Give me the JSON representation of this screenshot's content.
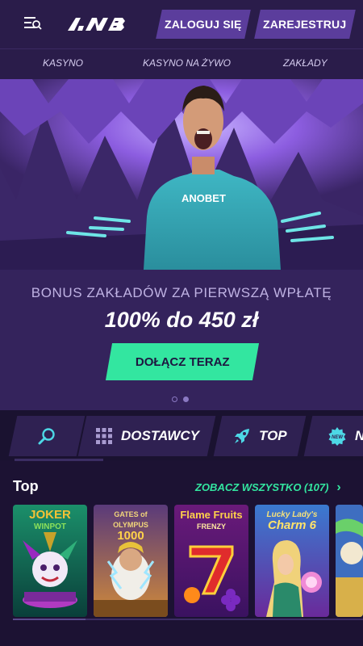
{
  "header": {
    "logo_text": "ANB",
    "login_label": "ZALOGUJ SIĘ",
    "register_label": "ZAREJESTRUJ",
    "menu_icon": "menu-search-icon"
  },
  "nav": {
    "items": [
      {
        "label": "KASYNO"
      },
      {
        "label": "KASYNO NA ŻYWO"
      },
      {
        "label": "ZAKŁADY"
      }
    ]
  },
  "hero": {
    "jersey_text": "ANOBET",
    "subtitle": "BONUS ZAKŁADÓW ZA PIERWSZĄ WPŁATĘ",
    "title": "100% do 450 zł",
    "cta_label": "DOŁĄCZ TERAZ",
    "slides": 2,
    "active_slide": 2
  },
  "filters": {
    "search_icon": "search-icon",
    "providers_label": "DOSTAWCY",
    "top_label": "TOP",
    "new_label": "N",
    "new_badge": "NEW"
  },
  "top_section": {
    "title": "Top",
    "see_all_label": "ZOBACZ WSZYSTKO (107)",
    "games": [
      {
        "name": "JOKER WINPOT",
        "line1": "JOKER",
        "line2": "WINPOT"
      },
      {
        "name": "GATES of OLYMPUS 1000",
        "line1": "GATES of OLYMPUS",
        "line2": "1000"
      },
      {
        "name": "Flame Fruits FRENZY",
        "line1": "Flame Fruits",
        "line2": "FRENZY"
      },
      {
        "name": "Lucky Lady's Charm 6",
        "line1": "Lucky Lady's",
        "line2": "Charm 6"
      }
    ]
  },
  "colors": {
    "background": "#1c1233",
    "header": "#2a1c4a",
    "button": "#5b3d9c",
    "accent_green": "#33e6a0",
    "hero_bg": "#34235c"
  }
}
